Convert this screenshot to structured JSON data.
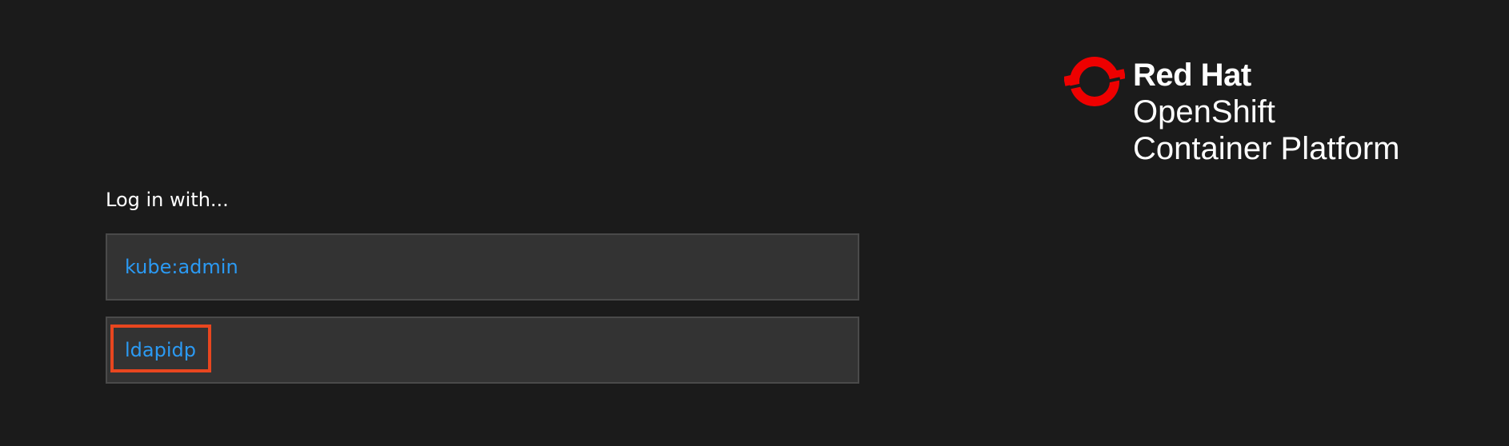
{
  "brand": {
    "line1": "Red Hat",
    "line2": "OpenShift",
    "line3": "Container Platform",
    "logo_icon": "red-hat-openshift-logo-icon",
    "logo_color": "#ee0000"
  },
  "login": {
    "heading": "Log in with...",
    "providers": [
      {
        "label": "kube:admin"
      },
      {
        "label": "ldapidp",
        "highlighted": true
      }
    ],
    "link_color": "#2b9af3",
    "highlight_color": "#e8461f"
  }
}
